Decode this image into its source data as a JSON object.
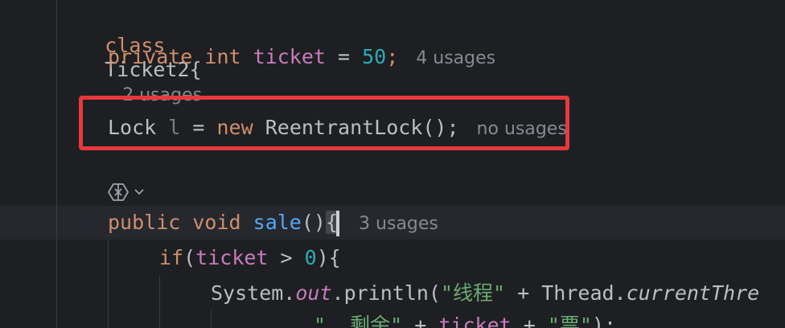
{
  "editor": {
    "lines": {
      "class_decl": {
        "keyword": "class",
        "name": "Ticket2{",
        "hint": "2 usages"
      },
      "field_decl": {
        "modifier": "private",
        "type": "int",
        "name": "ticket",
        "assign": " = ",
        "value": "50",
        "end": ";",
        "hint": "4 usages"
      },
      "lock_decl": {
        "type": "Lock",
        "var": "l",
        "assign": " = ",
        "keyword": "new",
        "ctor": "ReentrantLock();",
        "hint": "no usages"
      },
      "method_decl": {
        "modifier": "public",
        "type": "void",
        "name": "sale",
        "parens": "()",
        "brace": "{",
        "hint": "3 usages"
      },
      "if_line": {
        "keyword": "if",
        "open": "(",
        "field": "ticket",
        "op": " > ",
        "num": "0",
        "close": "){"
      },
      "println_line": {
        "cls": "System.",
        "out": "out",
        "call": ".println(",
        "str": "\"线程\"",
        "plus": " + Thread.",
        "method": "currentThre"
      },
      "cont_line": {
        "str1": "\", 剩余\"",
        "plus1": " + ",
        "field": "ticket",
        "plus2": " + ",
        "str2": "\"票\"",
        "end": ");"
      }
    },
    "icons": {
      "ai_assistant": "ai-assistant-icon",
      "chevron": "chevron-down-icon"
    },
    "colors": {
      "background": "#1e1f22",
      "keyword": "#cf8e6d",
      "field": "#c77dbb",
      "number": "#2aacb8",
      "function": "#56a8f5",
      "string": "#6aab73",
      "highlight_box": "#e6393c"
    }
  }
}
